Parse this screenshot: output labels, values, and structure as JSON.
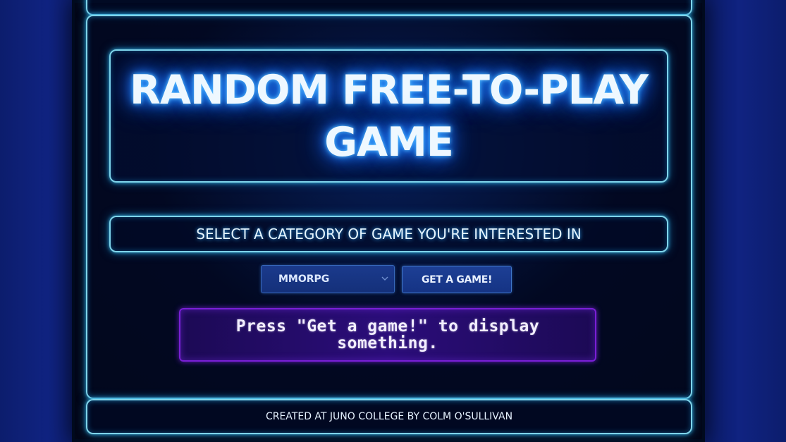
{
  "header": {
    "title": "RANDOM FREE-TO-PLAY GAME"
  },
  "prompt": {
    "text": "SELECT A CATEGORY OF GAME YOU'RE INTERESTED IN"
  },
  "controls": {
    "category_select": {
      "selected": "MMORPG"
    },
    "get_game_button": "GET A GAME!"
  },
  "result": {
    "message": "Press \"Get a game!\" to display something."
  },
  "footer": {
    "credit": "CREATED AT JUNO COLLEGE BY COLM O'SULLIVAN"
  },
  "colors": {
    "background": "#0c1d6d",
    "panel": "#020618",
    "neon_border": "#7fd4ea",
    "result_border": "#7a1fd6",
    "result_bg": "#2b0d7a"
  },
  "icons": {
    "select_chevron": "chevron-down-icon"
  }
}
